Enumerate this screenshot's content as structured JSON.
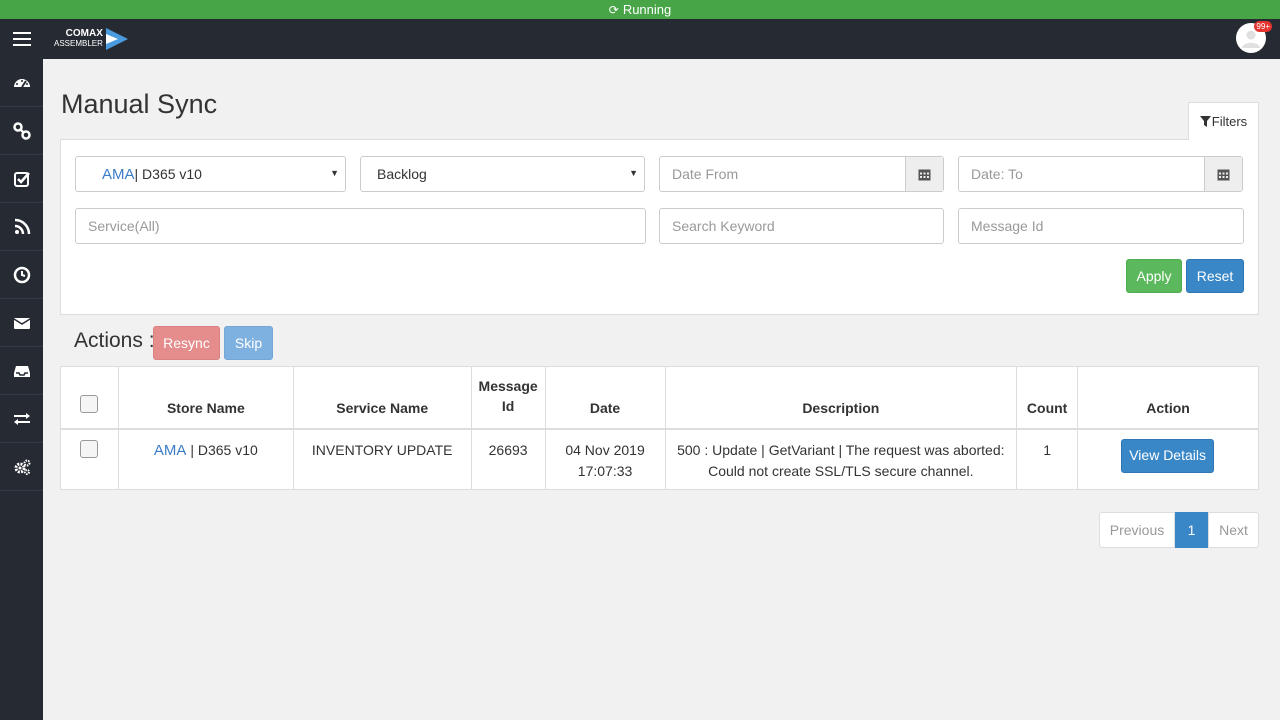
{
  "status": {
    "icon": "spinner-icon",
    "text": "Running",
    "color": "#47a447"
  },
  "topbar": {
    "logo_main": "COMAX",
    "logo_sub": "ASSEMBLER",
    "notification_badge": "99+"
  },
  "sidebar": {
    "items": [
      {
        "icon": "dashboard-icon"
      },
      {
        "icon": "link-icon"
      },
      {
        "icon": "checkbox-icon"
      },
      {
        "icon": "rss-icon"
      },
      {
        "icon": "clock-icon"
      },
      {
        "icon": "envelope-icon"
      },
      {
        "icon": "inbox-icon"
      },
      {
        "icon": "exchange-icon"
      },
      {
        "icon": "gears-icon"
      }
    ]
  },
  "page": {
    "title": "Manual Sync"
  },
  "filters": {
    "tab_label": "Filters",
    "store_select": {
      "ama": "AMA",
      "rest": "| D365 v10"
    },
    "status_select": "Backlog",
    "date_from_placeholder": "Date From",
    "date_to_placeholder": "Date: To",
    "service_placeholder": "Service(All)",
    "keyword_placeholder": "Search Keyword",
    "message_id_placeholder": "Message Id",
    "apply_label": "Apply",
    "reset_label": "Reset"
  },
  "actions": {
    "label": "Actions :",
    "resync_label": "Resync",
    "skip_label": "Skip"
  },
  "table": {
    "headers": {
      "store_name": "Store Name",
      "service_name": "Service Name",
      "message_id_1": "Message",
      "message_id_2": "Id",
      "date": "Date",
      "description": "Description",
      "count": "Count",
      "action": "Action"
    },
    "rows": [
      {
        "store_ama": "AMA",
        "store_rest": "| D365 v10",
        "service": "INVENTORY UPDATE",
        "message_id": "26693",
        "date_1": "04 Nov 2019",
        "date_2": "17:07:33",
        "description_1": "500 : Update | GetVariant | The request was aborted:",
        "description_2": "Could not create SSL/TLS secure channel.",
        "count": "1",
        "action_label": "View Details"
      }
    ]
  },
  "pagination": {
    "previous": "Previous",
    "current": "1",
    "next": "Next"
  }
}
